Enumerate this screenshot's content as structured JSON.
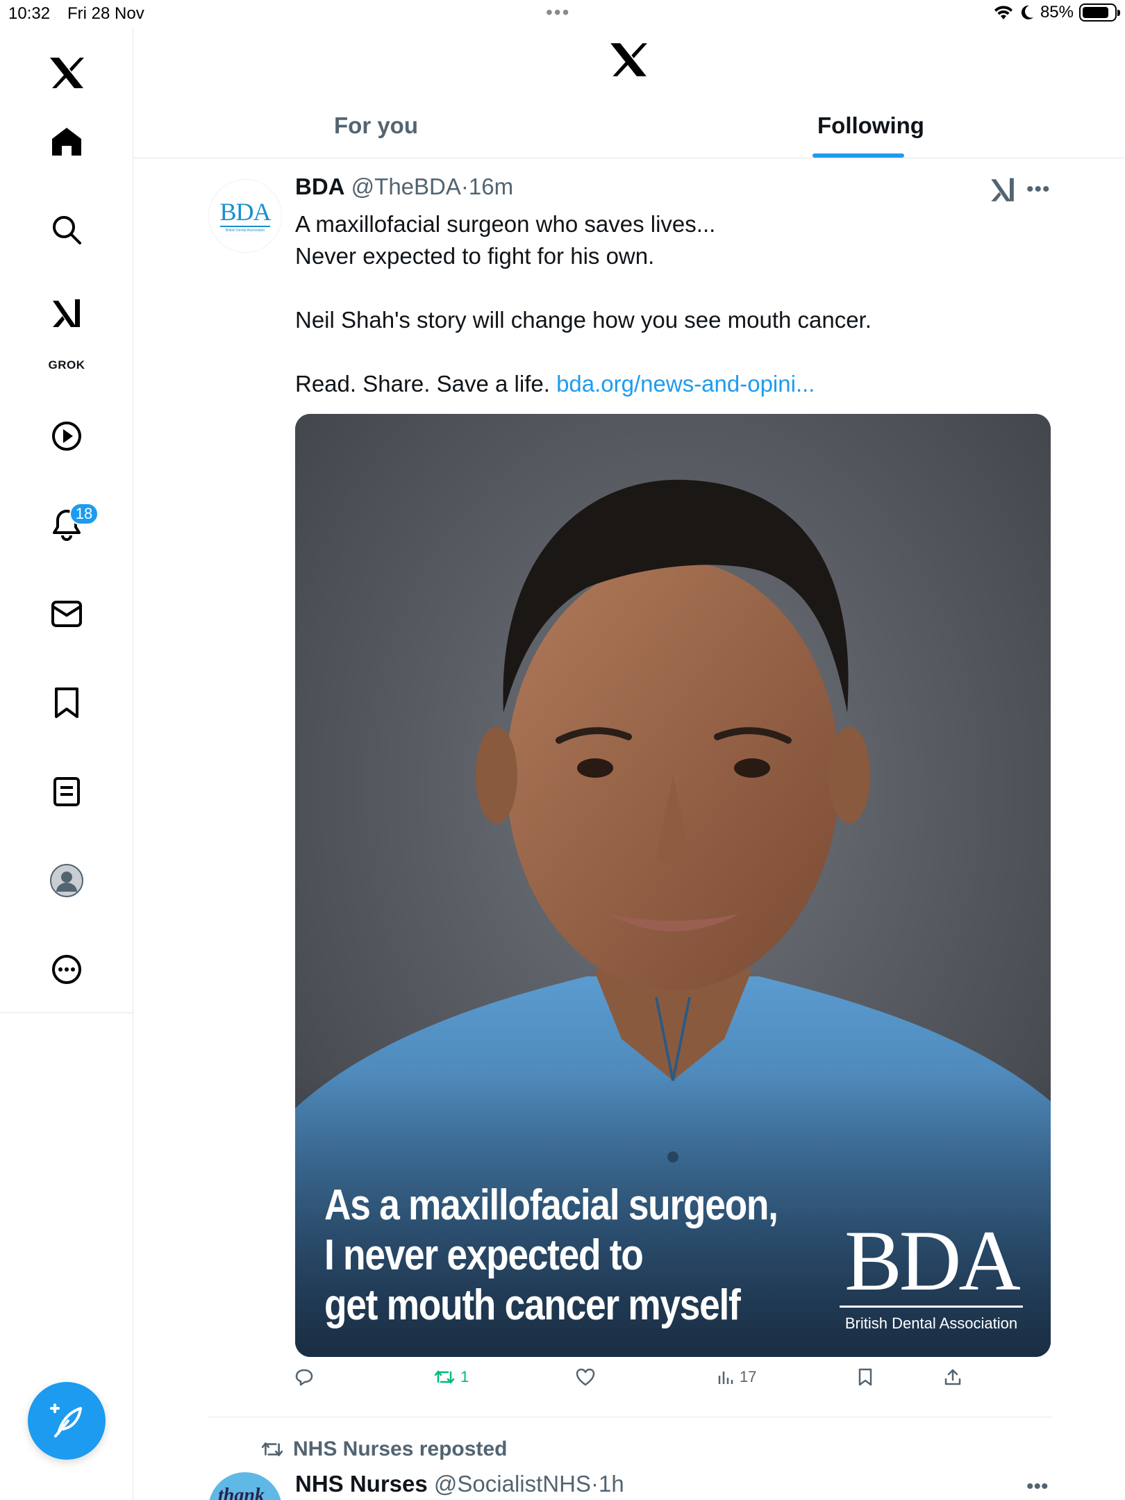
{
  "status_bar": {
    "time": "10:32",
    "date": "Fri 28 Nov",
    "battery": "85%",
    "battery_level": 0.85
  },
  "sidebar": {
    "items": [
      {
        "name": "home",
        "icon": "home-icon"
      },
      {
        "name": "explore",
        "icon": "search-icon"
      },
      {
        "name": "grok",
        "icon": "grok-icon",
        "label": "GROK"
      },
      {
        "name": "videos",
        "icon": "play-icon"
      },
      {
        "name": "notifications",
        "icon": "bell-icon",
        "badge": "18"
      },
      {
        "name": "messages",
        "icon": "mail-icon"
      },
      {
        "name": "bookmarks",
        "icon": "bookmark-icon"
      },
      {
        "name": "lists",
        "icon": "list-icon"
      },
      {
        "name": "profile",
        "icon": "avatar-icon"
      },
      {
        "name": "more",
        "icon": "more-circle-icon"
      }
    ],
    "compose_icon": "compose-feather-icon"
  },
  "header": {
    "tabs": [
      {
        "label": "For you",
        "active": false
      },
      {
        "label": "Following",
        "active": true
      }
    ],
    "accent": "#1d9bf0"
  },
  "tweet": {
    "avatar": {
      "text": "BDA",
      "subtext": "British Dental Association"
    },
    "name": "BDA",
    "handle": "@TheBDA",
    "separator": "·",
    "time": "16m",
    "lines": [
      "A maxillofacial surgeon who saves lives...",
      "Never expected to fight for his own.",
      "",
      "Neil Shah's story will change how you see mouth cancer.",
      "",
      "Read. Share. Save a life. "
    ],
    "link_text": "bda.org/news-and-opini...",
    "media": {
      "caption_lines": [
        "As a maxillofacial surgeon,",
        "I never expected to",
        "get mouth cancer myself"
      ],
      "logo_big": "BDA",
      "logo_small": "British Dental Association"
    },
    "actions": {
      "reply": "",
      "reposts": "1",
      "likes": "",
      "views": "17"
    }
  },
  "tweet2": {
    "repost_label": "NHS Nurses reposted",
    "avatar_text": "thank",
    "name": "NHS Nurses",
    "handle": "@SocialistNHS",
    "separator": "·",
    "time": "1h"
  }
}
